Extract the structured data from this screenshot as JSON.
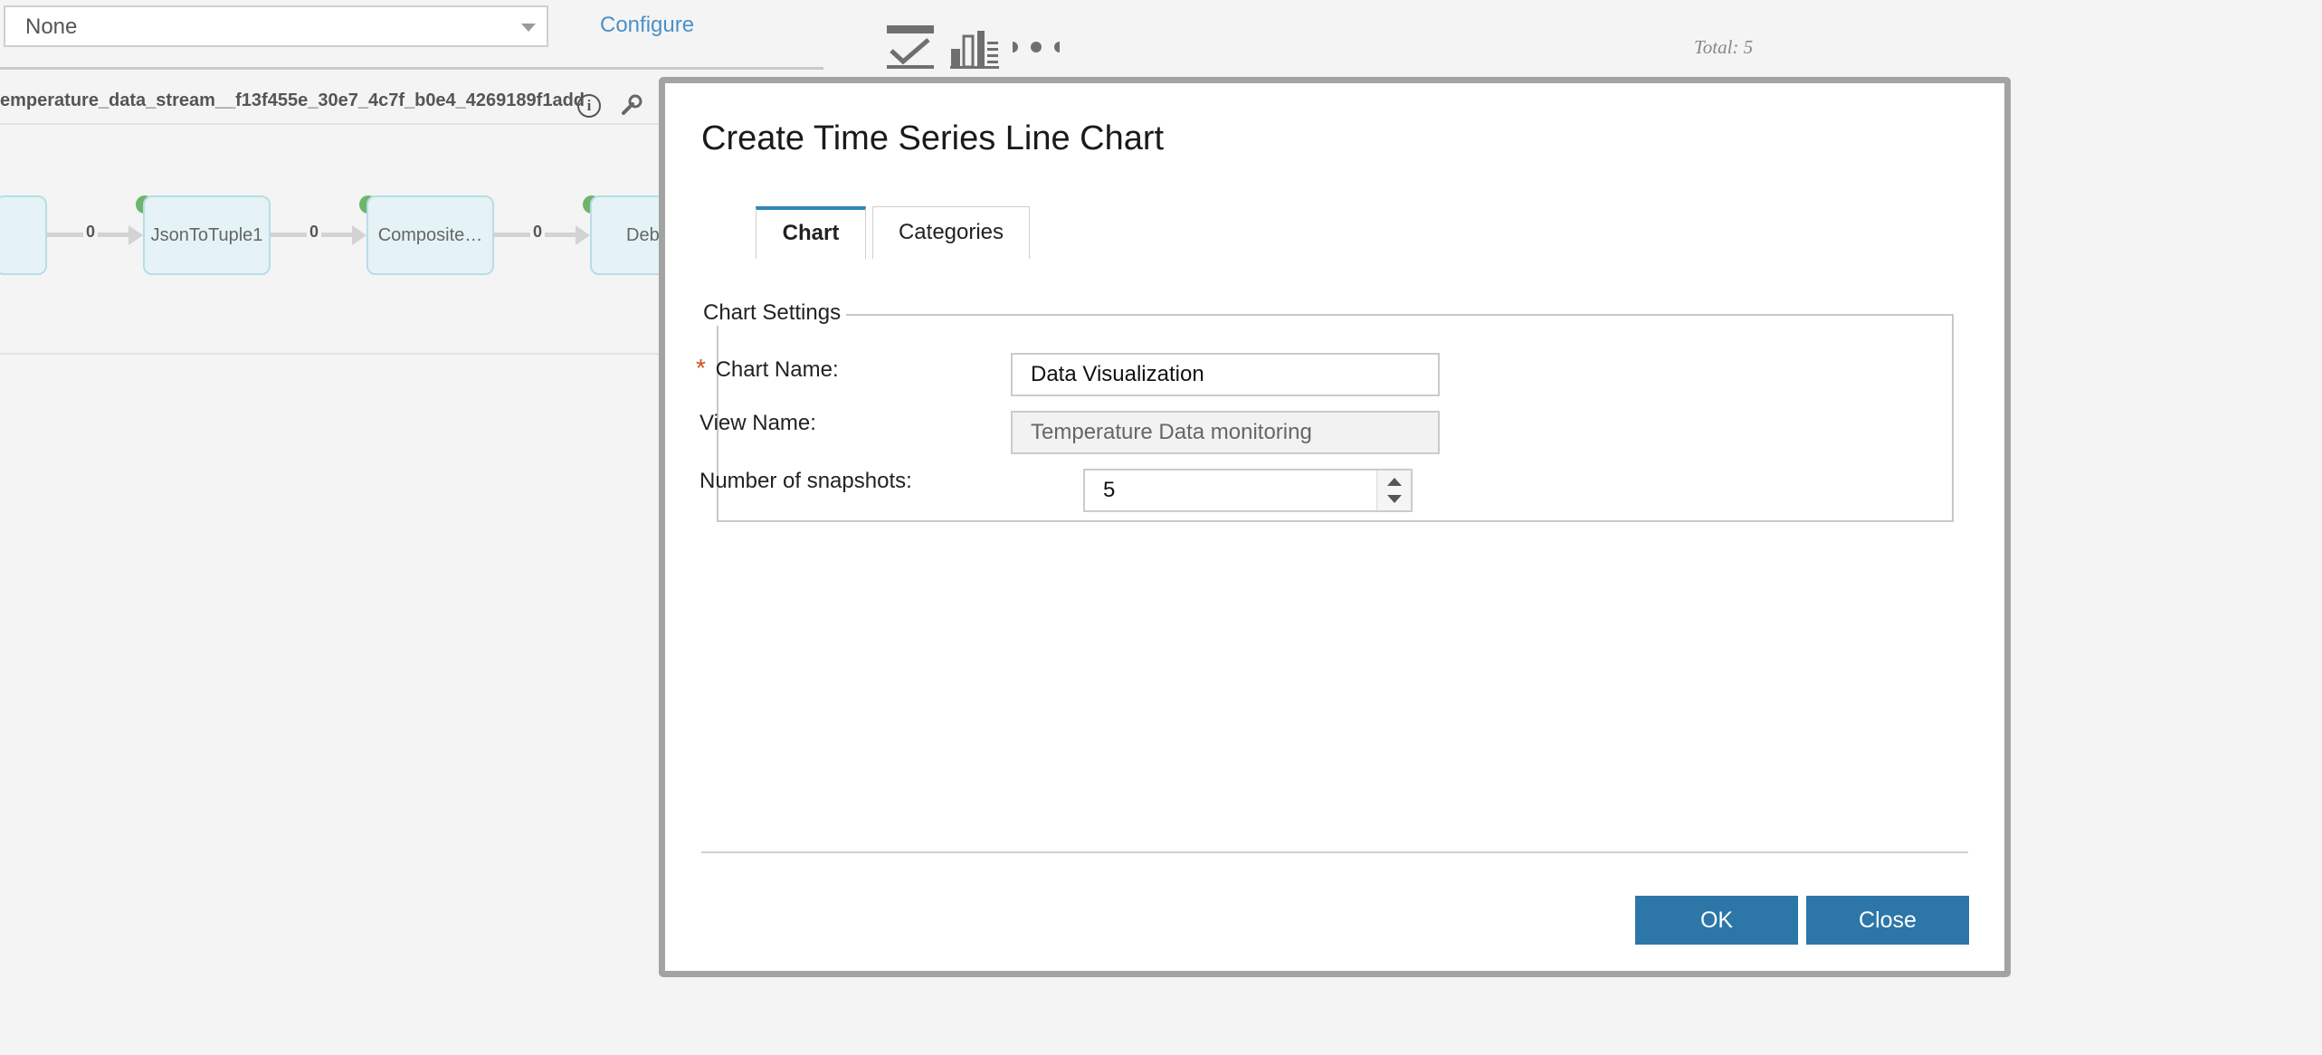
{
  "background": {
    "filter_select": {
      "value": "None"
    },
    "configure_link": "Configure",
    "total_label": "Total: 5",
    "stream_title": "emperature_data_stream__f13f455e_30e7_4c7f_b0e4_4269189f1add",
    "info_icon_glyph": "i",
    "nodes": [
      {
        "label": ""
      },
      {
        "label": "JsonToTuple1"
      },
      {
        "label": "Composite…"
      },
      {
        "label": "Deb"
      }
    ],
    "connections": [
      "0",
      "0",
      "0"
    ],
    "icons": [
      "line-chart-icon",
      "bar-chart-icon",
      "more-icon",
      "info-icon",
      "wrench-icon"
    ],
    "colors": {
      "link": "#4a90c8",
      "node_fill": "#e5f3f6",
      "node_status": "#6db46d"
    }
  },
  "dialog": {
    "title": "Create Time Series Line Chart",
    "tabs": [
      {
        "label": "Chart",
        "active": true
      },
      {
        "label": "Categories",
        "active": false
      }
    ],
    "fieldset_legend": "Chart Settings",
    "required_marker": "*",
    "fields": {
      "chart_name": {
        "label": "Chart Name:",
        "value": "Data Visualization"
      },
      "view_name": {
        "label": "View Name:",
        "value": "Temperature Data monitoring"
      },
      "snapshots": {
        "label": "Number of snapshots:",
        "value": "5"
      }
    },
    "buttons": {
      "ok": "OK",
      "close": "Close"
    },
    "colors": {
      "primary_button": "#2c76a8",
      "active_tab_accent": "#2f86b8",
      "required": "#d0501f"
    }
  }
}
